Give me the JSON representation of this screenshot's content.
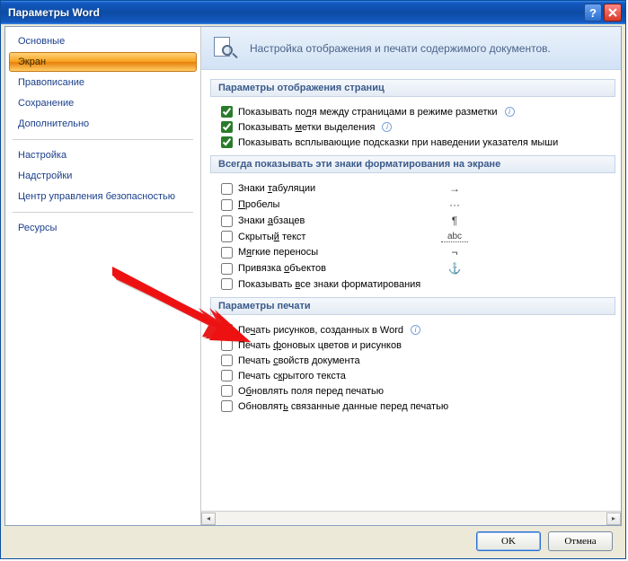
{
  "window": {
    "title": "Параметры Word"
  },
  "sidebar": {
    "items": [
      {
        "label": "Основные"
      },
      {
        "label": "Экран"
      },
      {
        "label": "Правописание"
      },
      {
        "label": "Сохранение"
      },
      {
        "label": "Дополнительно"
      },
      {
        "label": "Настройка"
      },
      {
        "label": "Надстройки"
      },
      {
        "label": "Центр управления безопасностью"
      },
      {
        "label": "Ресурсы"
      }
    ],
    "selected": 1,
    "separators_after": [
      4,
      7
    ]
  },
  "header": {
    "text": "Настройка отображения и печати содержимого документов."
  },
  "sections": {
    "display": {
      "title": "Параметры отображения страниц",
      "items": [
        {
          "label": "Показывать поля между страницами в режиме разметки",
          "checked": true,
          "info": true
        },
        {
          "label": "Показывать метки выделения",
          "checked": true,
          "info": true
        },
        {
          "label": "Показывать всплывающие подсказки при наведении указателя мыши",
          "checked": true
        }
      ]
    },
    "marks": {
      "title": "Всегда показывать эти знаки форматирования на экране",
      "items": [
        {
          "label": "Знаки табуляции",
          "checked": false,
          "symbol": "→"
        },
        {
          "label": "Пробелы",
          "checked": false,
          "symbol": "···"
        },
        {
          "label": "Знаки абзацев",
          "checked": false,
          "symbol": "¶"
        },
        {
          "label": "Скрытый текст",
          "checked": false,
          "symbol": "abc",
          "dotted": true
        },
        {
          "label": "Мягкие переносы",
          "checked": false,
          "symbol": "¬"
        },
        {
          "label": "Привязка объектов",
          "checked": false,
          "symbol": "⚓"
        },
        {
          "label": "Показывать все знаки форматирования",
          "checked": false
        }
      ]
    },
    "print": {
      "title": "Параметры печати",
      "items": [
        {
          "label": "Печать рисунков, созданных в Word",
          "checked": true,
          "info": true
        },
        {
          "label": "Печать фоновых цветов и рисунков",
          "checked": false
        },
        {
          "label": "Печать свойств документа",
          "checked": false
        },
        {
          "label": "Печать скрытого текста",
          "checked": false
        },
        {
          "label": "Обновлять поля перед печатью",
          "checked": false
        },
        {
          "label": "Обновлять связанные данные перед печатью",
          "checked": false
        }
      ]
    }
  },
  "footer": {
    "ok": "OK",
    "cancel": "Отмена"
  }
}
